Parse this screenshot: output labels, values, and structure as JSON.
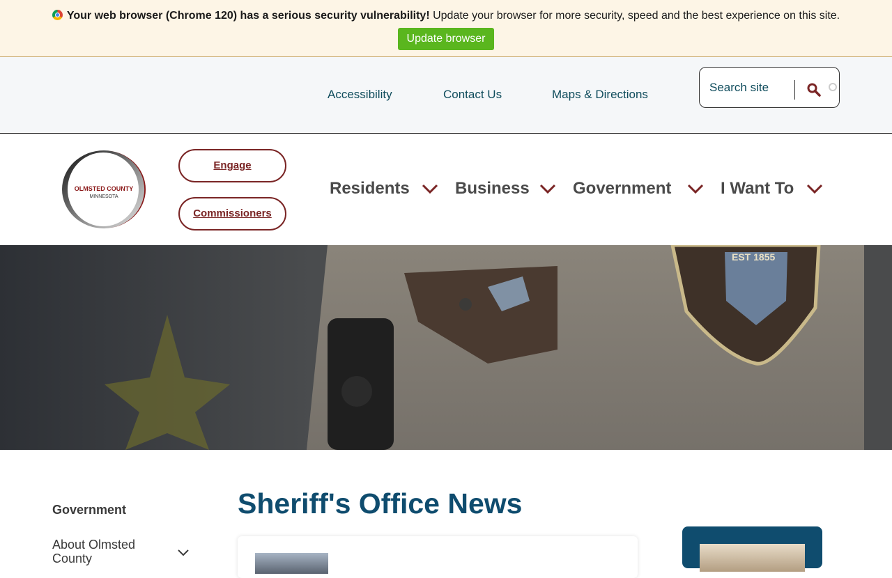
{
  "banner": {
    "warning_bold": "Your web browser (Chrome 120) has a serious security vulnerability!",
    "warning_text": " Update your browser for more security, speed and the best experience on this site.",
    "update_button": "Update browser"
  },
  "utility_nav": {
    "links": [
      "Accessibility",
      "Contact Us",
      "Maps & Directions"
    ],
    "search_placeholder": "Search site"
  },
  "logo": {
    "line1": "OLMSTED COUNTY",
    "line2": "MINNESOTA"
  },
  "pills": [
    "Engage",
    "Commissioners"
  ],
  "main_nav": [
    "Residents",
    "Business",
    "Government",
    "I Want To"
  ],
  "sidebar": {
    "heading": "Government",
    "items": [
      "About Olmsted County"
    ]
  },
  "page": {
    "title": "Sheriff's Office News"
  },
  "colors": {
    "accent_maroon": "#7a2525",
    "teal": "#0f4c5c",
    "title_blue": "#0f4c6e",
    "update_green": "#5ab61e",
    "banner_bg": "#fdf5e6"
  }
}
